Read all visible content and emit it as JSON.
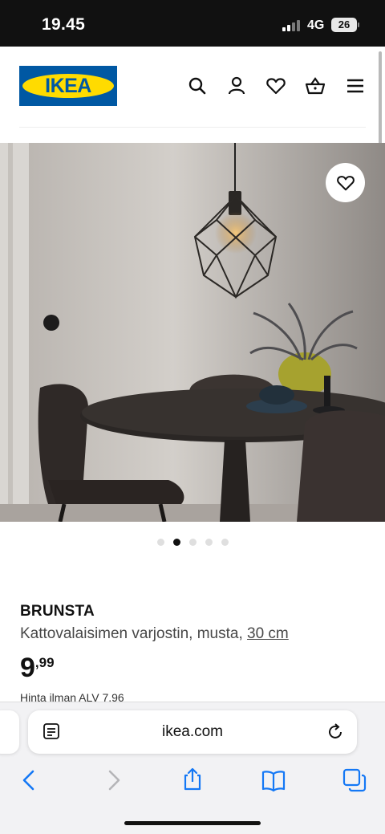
{
  "status": {
    "time": "19.45",
    "network": "4G",
    "battery": "26"
  },
  "header": {
    "logo_text": "IKEA",
    "brand_blue": "#0058a3",
    "brand_yellow": "#ffdb00"
  },
  "carousel": {
    "image_count": 5,
    "active_index": 1
  },
  "product": {
    "name": "BRUNSTA",
    "description": "Kattovalaisimen varjostin, musta,",
    "size_link": "30 cm",
    "price_int": "9",
    "price_dec": ",99",
    "price_note": "Hinta ilman ALV 7,96"
  },
  "browser": {
    "url": "ikea.com"
  },
  "icons": [
    "search-icon",
    "account-icon",
    "heart-icon",
    "basket-icon",
    "menu-icon",
    "favourite-icon",
    "reader-icon",
    "reload-icon",
    "back-icon",
    "forward-icon",
    "share-icon",
    "bookmarks-icon",
    "tabs-icon"
  ]
}
